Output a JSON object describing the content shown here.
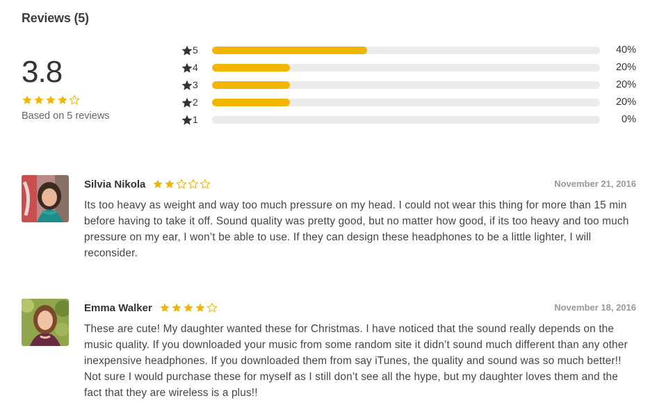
{
  "header": {
    "title": "Reviews (5)"
  },
  "summary": {
    "score": "3.8",
    "rating": 3.8,
    "based_on": "Based on 5 reviews"
  },
  "distribution": [
    {
      "stars": "5",
      "percent_label": "40%",
      "fraction": 0.4
    },
    {
      "stars": "4",
      "percent_label": "20%",
      "fraction": 0.2
    },
    {
      "stars": "3",
      "percent_label": "20%",
      "fraction": 0.2
    },
    {
      "stars": "2",
      "percent_label": "20%",
      "fraction": 0.2
    },
    {
      "stars": "1",
      "percent_label": "0%",
      "fraction": 0.0
    }
  ],
  "reviews": [
    {
      "name": "Silvia Nikola",
      "rating": 2,
      "date": "November 21, 2016",
      "text": "Its too heavy as weight and way too much pressure on my head. I could not wear this thing for more than 15 min before having to take it off. Sound quality was pretty good, but no matter how good, if its too heavy and too much pressure on my ear, I won’t be able to use. If they can design these headphones to be a little lighter, I will reconsider."
    },
    {
      "name": "Emma Walker",
      "rating": 4,
      "date": "November 18, 2016",
      "text": "These are cute! My daughter wanted these for Christmas. I have noticed that the sound really depends on the music quality. If you downloaded your music from some random site it didn’t sound much different than any other inexpensive headphones. If you downloaded them from say iTunes, the quality and sound was so much better!! Not sure I would purchase these for myself as I still don’t see all the hype, but my daughter loves them and the fact that they are wireless is a plus!!"
    }
  ],
  "colors": {
    "star_filled": "#f2b600",
    "bar_fill": "#f2b600",
    "bar_track": "#ebebeb",
    "dist_star": "#333333"
  },
  "icons": {
    "filled_star": "star-filled-icon",
    "empty_star": "star-outline-icon",
    "dist_star": "star-filled-icon"
  }
}
